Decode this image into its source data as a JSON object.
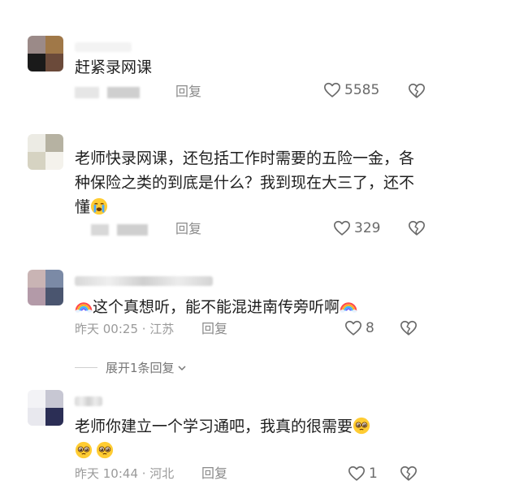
{
  "comments": [
    {
      "text": "赶紧录网课",
      "meta": "",
      "reply_label": "回复",
      "likes": "5585"
    },
    {
      "text": "老师快录网课，还包括工作时需要的五险一金，各种保险之类的到底是什么？我到现在大三了，还不懂",
      "meta": "",
      "reply_label": "回复",
      "likes": "329"
    },
    {
      "text": "这个真想听，能不能混进南传旁听啊",
      "meta": "昨天 00:25 · 江苏",
      "reply_label": "回复",
      "likes": "8",
      "expand_label": "展开1条回复"
    },
    {
      "text": "老师你建立一个学习通吧，我真的很需要",
      "meta": "昨天 10:44 · 河北",
      "reply_label": "回复",
      "likes": "1"
    }
  ],
  "icons": {
    "like": "heart-outline-icon",
    "dislike": "broken-heart-icon",
    "expand": "chevron-down-icon",
    "emoji_cry": "crying-face-emoji",
    "emoji_plead": "pleading-face-emoji",
    "emoji_rainbow": "rainbow-emoji"
  },
  "colors": {
    "text": "#1f1f1f",
    "meta": "#9a9a9a",
    "icon": "#6a6a6a"
  }
}
